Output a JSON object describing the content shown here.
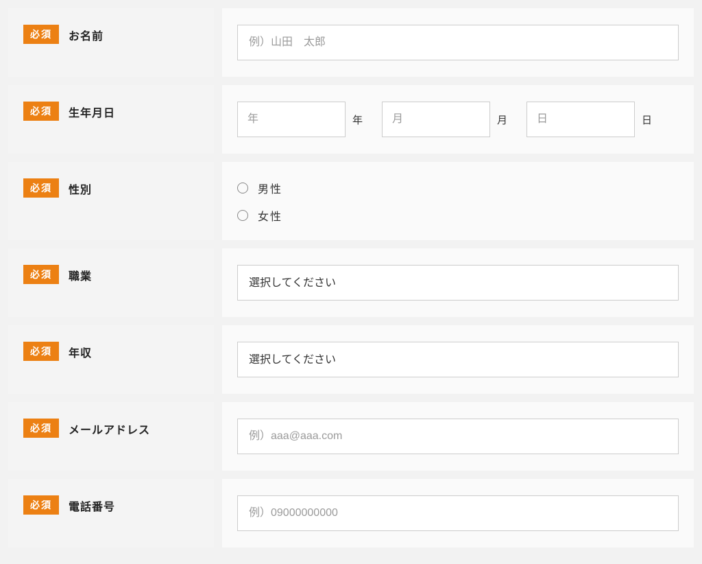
{
  "required_badge": "必須",
  "fields": {
    "name": {
      "label": "お名前",
      "placeholder": "例）山田　太郎"
    },
    "dob": {
      "label": "生年月日",
      "year_ph": "年",
      "month_ph": "月",
      "day_ph": "日",
      "year_suffix": "年",
      "month_suffix": "月",
      "day_suffix": "日"
    },
    "gender": {
      "label": "性別",
      "male": "男性",
      "female": "女性"
    },
    "occupation": {
      "label": "職業",
      "placeholder": "選択してください"
    },
    "income": {
      "label": "年収",
      "placeholder": "選択してください"
    },
    "email": {
      "label": "メールアドレス",
      "placeholder": "例）aaa@aaa.com"
    },
    "phone": {
      "label": "電話番号",
      "placeholder": "例）09000000000"
    }
  }
}
